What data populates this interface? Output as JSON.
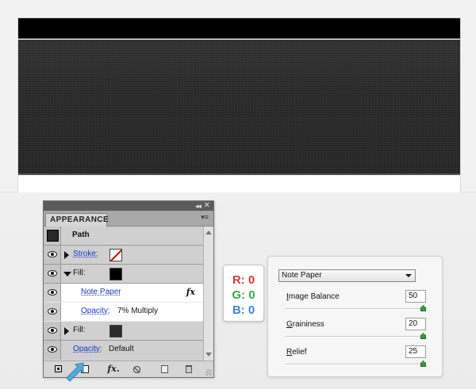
{
  "appearance_panel": {
    "title": "APPEARANCE",
    "chrome": {
      "collapse_glyph": "◂◂",
      "close_glyph": "✕",
      "menu_glyph": "▾≡"
    },
    "target": {
      "label": "Path",
      "thumb_color": "#2a2a2a"
    },
    "rows": {
      "stroke": {
        "label": "Stroke:",
        "swatch": "none"
      },
      "fill_top": {
        "label": "Fill:",
        "swatch_color": "#000000"
      },
      "effect": {
        "label": "Note Paper",
        "fx_glyph": "fx"
      },
      "fill_opacity": {
        "label": "Opacity:",
        "value": "7% Multiply"
      },
      "fill_bottom": {
        "label": "Fill:",
        "swatch_color": "#2b2b2b"
      },
      "opacity": {
        "label": "Opacity:",
        "value": "Default"
      }
    },
    "footer": {
      "fx_label": "fx",
      "fx_suffix": "."
    }
  },
  "rgb_readout": {
    "r": {
      "text": "R: 0",
      "color": "#d23a3a"
    },
    "g": {
      "text": "G: 0",
      "color": "#3aa64a"
    },
    "b": {
      "text": "B: 0",
      "color": "#3c86c8"
    }
  },
  "note_paper_settings": {
    "filter": "Note Paper",
    "params": [
      {
        "label_first": "I",
        "label_rest": "mage Balance",
        "value": "50",
        "level": 1.0
      },
      {
        "label_first": "G",
        "label_rest": "raininess",
        "value": "20",
        "level": 1.0
      },
      {
        "label_first": "R",
        "label_rest": "elief",
        "value": "25",
        "level": 1.0
      }
    ]
  },
  "colors": {
    "accent_green": "#3d9a3d",
    "pointer_blue": "#5aa9de",
    "link_blue": "#1a35c4"
  }
}
